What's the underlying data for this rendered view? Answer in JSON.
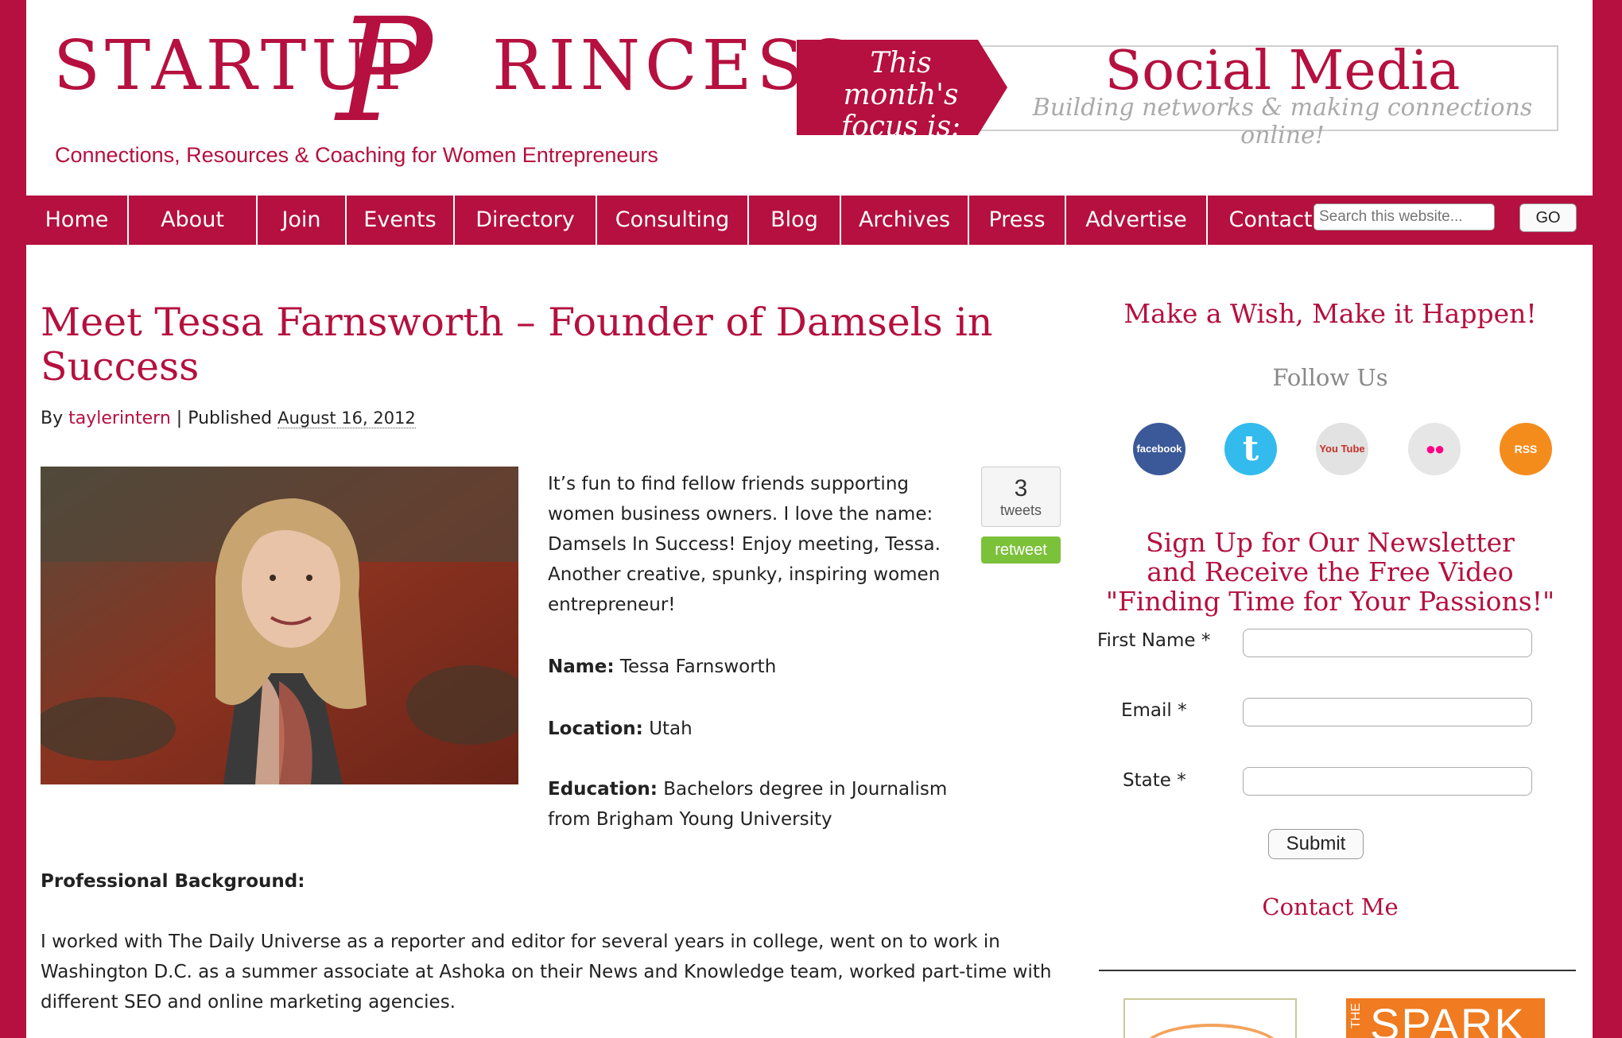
{
  "header": {
    "logo_startup": "STARTUP",
    "logo_p": "P",
    "logo_rincess": "RINCESS",
    "tagline": "Connections, Resources & Coaching for Women Entrepreneurs",
    "focus_label": "This month's focus is:",
    "focus_topic": "Social Media",
    "focus_subtitle": "Building networks & making connections online!"
  },
  "nav": {
    "items": [
      "Home",
      "About",
      "Join",
      "Events",
      "Directory",
      "Consulting",
      "Blog",
      "Archives",
      "Press",
      "Advertise",
      "Contact"
    ],
    "search_placeholder": "Search this website...",
    "go_label": "GO"
  },
  "article": {
    "title": "Meet Tessa Farnsworth – Founder of Damsels in Success",
    "by_label": "By",
    "author": "taylerintern",
    "separator": "|",
    "published_label": "Published",
    "date": "August 16, 2012",
    "intro": "It’s fun to find fellow friends supporting women business owners.  I love the name: Damsels In Success!  Enjoy meeting, Tessa. Another creative, spunky, inspiring women entrepreneur!",
    "name_label": "Name:",
    "name_value": "Tessa Farnsworth",
    "location_label": "Location:",
    "location_value": "Utah",
    "education_label": "Education:",
    "education_value": "Bachelors degree in Journalism from Brigham Young University",
    "background_label": "Professional Background:",
    "background_text": "I worked with The Daily Universe as a reporter and editor for several years in college, went on to work in Washington D.C. as a summer associate at Ashoka on their News and Knowledge team, worked part-time with different SEO and online marketing agencies."
  },
  "tweet": {
    "count": "3",
    "count_label": "tweets",
    "button_label": "retweet"
  },
  "sidebar": {
    "wish_heading": "Make a Wish, Make it Happen!",
    "follow_heading": "Follow Us",
    "social": [
      {
        "name": "facebook",
        "label": "facebook",
        "color": "#3b5998"
      },
      {
        "name": "twitter",
        "label": "t",
        "color": "#33bbee"
      },
      {
        "name": "youtube",
        "label": "You Tube",
        "color": "#dddddd"
      },
      {
        "name": "flickr",
        "label": "●●",
        "color": "#e6e6e6"
      },
      {
        "name": "rss",
        "label": "RSS",
        "color": "#f48c1c"
      }
    ],
    "newsletter_heading": "Sign Up for Our Newsletter\nand Receive the Free Video\n\"Finding Time for Your Passions!\"",
    "first_name_label": "First Name *",
    "email_label": "Email *",
    "state_label": "State *",
    "submit_label": "Submit",
    "contact_heading": "Contact Me",
    "ad_spark_the": "THE",
    "ad_spark": "SPARK"
  },
  "colors": {
    "brand": "#b5103f",
    "retweet": "#7cc13a",
    "spark": "#f07b20"
  }
}
